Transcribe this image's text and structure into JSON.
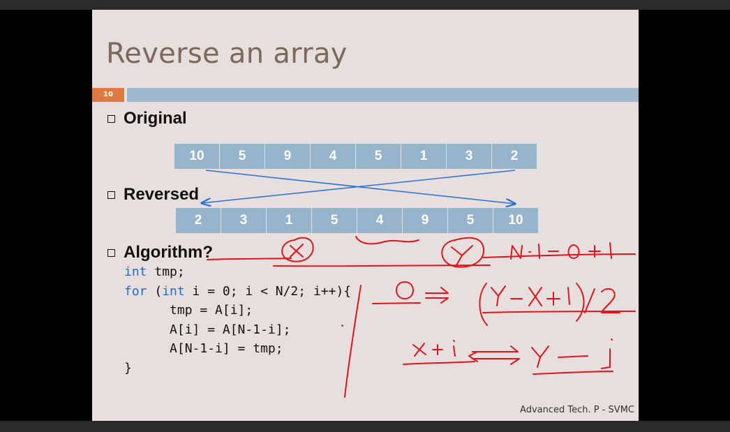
{
  "slide": {
    "title": "Reverse an array",
    "slide_number": "10",
    "footer": "Advanced Tech. P - SVMC"
  },
  "original": {
    "label": "Original",
    "values": [
      "10",
      "5",
      "9",
      "4",
      "5",
      "1",
      "3",
      "2"
    ]
  },
  "reversed": {
    "label": "Reversed",
    "values": [
      "2",
      "3",
      "1",
      "5",
      "4",
      "9",
      "5",
      "10"
    ]
  },
  "algorithm": {
    "label": "Algorithm?",
    "code": {
      "l1_kw": "int",
      "l1_rest": " tmp;",
      "l2_kw1": "for",
      "l2_a": " (",
      "l2_kw2": "int",
      "l2_b": " i = 0; i < N/2; i++){",
      "l3": "      tmp = A[i];",
      "l4": "      A[i] = A[N-1-i];",
      "l5": "      A[N-1-i] = tmp;",
      "l6": "}"
    }
  },
  "colors": {
    "title": "#7b6a5c",
    "badge": "#dd7a42",
    "topic_bar": "#9fb8cf",
    "cell": "#97b4cd",
    "keyword": "#1f6fd1",
    "arrow": "#2a6fd8",
    "ink": "#e0141a"
  }
}
